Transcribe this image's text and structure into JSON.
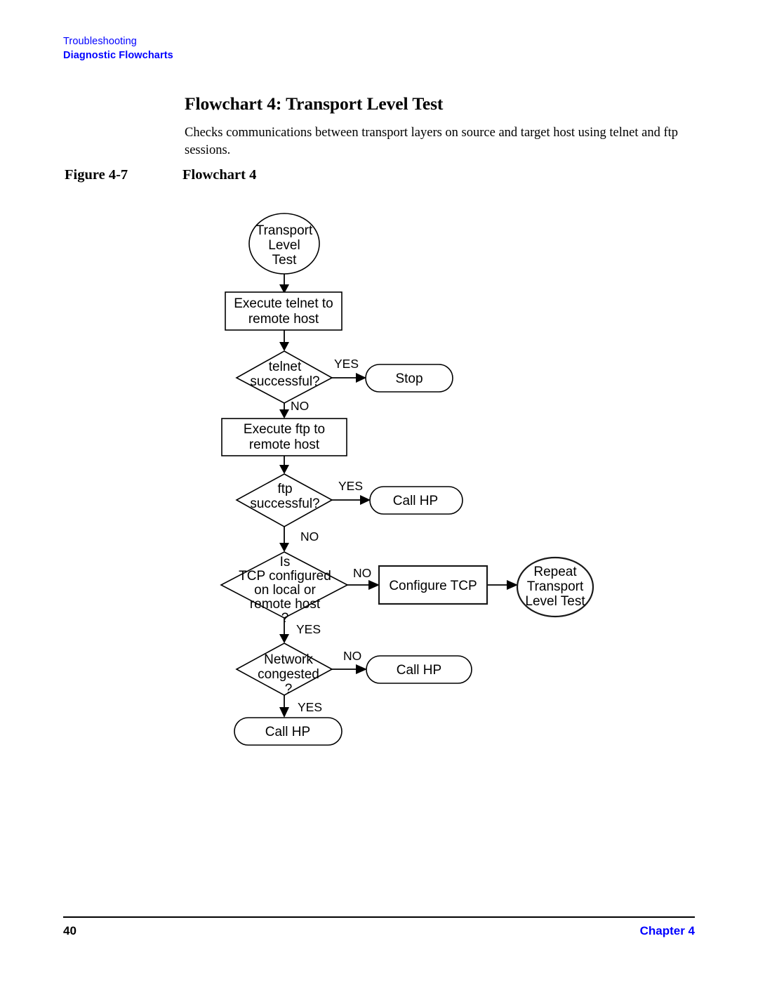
{
  "header": {
    "section": "Troubleshooting",
    "subsection": "Diagnostic Flowcharts"
  },
  "section": {
    "title": "Flowchart 4: Transport Level Test",
    "intro": "Checks communications between transport layers on source and target host using telnet and ftp sessions."
  },
  "figure": {
    "number": "Figure 4-7",
    "title": "Flowchart 4"
  },
  "flowchart": {
    "nodes": {
      "start": {
        "shape": "ellipse",
        "lines": [
          "Transport",
          "Level",
          "Test"
        ]
      },
      "telnet_exec": {
        "shape": "process",
        "lines": [
          "Execute telnet to",
          "remote host"
        ]
      },
      "telnet_decision": {
        "shape": "decision",
        "lines": [
          "telnet",
          "successful?"
        ]
      },
      "stop": {
        "shape": "terminator",
        "lines": [
          "Stop"
        ]
      },
      "ftp_exec": {
        "shape": "process",
        "lines": [
          "Execute ftp to",
          "remote host"
        ]
      },
      "ftp_decision": {
        "shape": "decision",
        "lines": [
          "ftp",
          "successful?"
        ]
      },
      "ftp_callhp": {
        "shape": "terminator",
        "lines": [
          "Call HP"
        ]
      },
      "tcp_decision": {
        "shape": "decision",
        "lines": [
          "Is",
          "TCP configured",
          "on local or",
          "remote host",
          "?"
        ]
      },
      "configure_tcp": {
        "shape": "process",
        "lines": [
          "Configure TCP"
        ]
      },
      "repeat": {
        "shape": "ellipse",
        "lines": [
          "Repeat",
          "Transport",
          "Level Test"
        ]
      },
      "network_decision": {
        "shape": "decision",
        "lines": [
          "Network",
          "congested",
          "?"
        ]
      },
      "network_callhp": {
        "shape": "terminator",
        "lines": [
          "Call HP"
        ]
      },
      "final_callhp": {
        "shape": "terminator",
        "lines": [
          "Call HP"
        ]
      }
    },
    "edge_labels": {
      "telnet_yes": "YES",
      "telnet_no": "NO",
      "ftp_yes": "YES",
      "ftp_no": "NO",
      "tcp_no": "NO",
      "tcp_yes": "YES",
      "network_no": "NO",
      "network_yes": "YES"
    }
  },
  "footer": {
    "page": "40",
    "chapter": "Chapter 4"
  }
}
